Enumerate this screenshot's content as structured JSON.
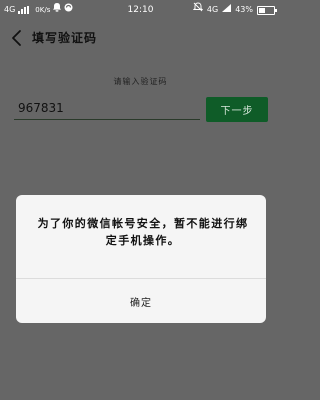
{
  "status_bar": {
    "network_left": "4G",
    "speed": "0K/s",
    "time": "12:10",
    "network_right": "4G",
    "battery": "43%",
    "icons": [
      "signal-icon",
      "app-notification-icon",
      "sync-icon",
      "mute-alarm-icon",
      "signal-icon",
      "battery-icon"
    ]
  },
  "header": {
    "title": "填写验证码"
  },
  "form": {
    "hint": "请输入验证码",
    "code_value": "967831",
    "next_label": "下一步"
  },
  "dialog": {
    "message": "为了你的微信帐号安全，暂不能进行绑定手机操作。",
    "confirm_label": "确定"
  },
  "colors": {
    "overlay_background": "#666666",
    "primary_button": "#0f5c28",
    "dialog_background": "#f5f5f5"
  }
}
